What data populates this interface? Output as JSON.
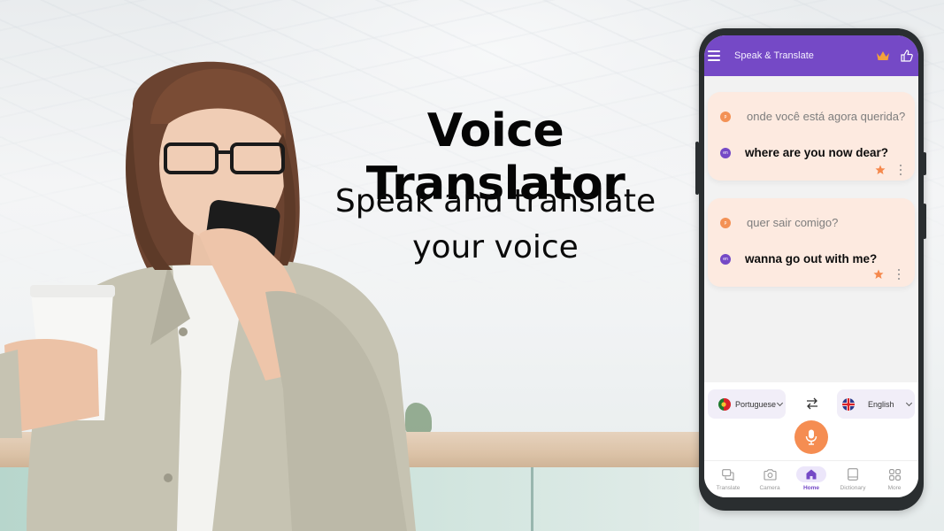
{
  "promo": {
    "headline": "Voice Translator",
    "subline_1": "Speak and translate",
    "subline_2": "your voice"
  },
  "app": {
    "title": "Speak & Translate",
    "icons": {
      "menu": "hamburger-menu-icon",
      "premium": "crown-icon",
      "rate": "thumbs-up-icon"
    },
    "colors": {
      "primary": "#7549c6",
      "accent": "#f58d52",
      "card_bg": "#fdeae0"
    }
  },
  "conversations": [
    {
      "source_lang_badge": "p",
      "source_text": "onde você está agora querida?",
      "target_lang_badge": "en",
      "target_text": "where are you now dear?",
      "favorited": true
    },
    {
      "source_lang_badge": "p",
      "source_text": "quer sair comigo?",
      "target_lang_badge": "en",
      "target_text": "wanna go out with me?",
      "favorited": true
    }
  ],
  "language_bar": {
    "source_language": "Portuguese",
    "target_language": "English",
    "swap_icon": "swap-arrows-icon",
    "mic_icon": "microphone-icon"
  },
  "bottom_nav": [
    {
      "label": "Translate",
      "icon": "chat-bubbles-icon",
      "active": false
    },
    {
      "label": "Camera",
      "icon": "camera-icon",
      "active": false
    },
    {
      "label": "Home",
      "icon": "home-icon",
      "active": true
    },
    {
      "label": "Dictionary",
      "icon": "book-icon",
      "active": false
    },
    {
      "label": "More",
      "icon": "grid-icon",
      "active": false
    }
  ]
}
